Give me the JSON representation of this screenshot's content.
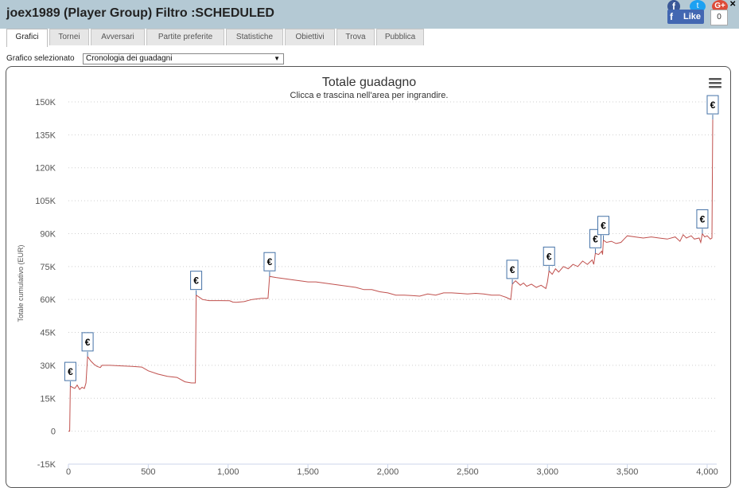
{
  "header": {
    "title": "joex1989 (Player Group) Filtro :SCHEDULED",
    "social": {
      "like_label": "Like",
      "like_count": "0",
      "facebook": "f",
      "twitter": "t",
      "gplus": "G+"
    }
  },
  "tabs": [
    {
      "label": "Grafici",
      "active": true
    },
    {
      "label": "Tornei",
      "active": false
    },
    {
      "label": "Avversari",
      "active": false
    },
    {
      "label": "Partite preferite",
      "active": false
    },
    {
      "label": "Statistiche",
      "active": false
    },
    {
      "label": "Obiettivi",
      "active": false
    },
    {
      "label": "Trova",
      "active": false
    },
    {
      "label": "Pubblica",
      "active": false
    }
  ],
  "selector": {
    "label": "Grafico selezionato",
    "value": "Cronologia dei guadagni"
  },
  "chart_data": {
    "type": "line",
    "title": "Totale guadagno",
    "subtitle": "Clicca e trascina nell'area per ingrandire.",
    "ylabel": "Totale cumulativo (EUR)",
    "xlabel": "",
    "ylim": [
      -15000,
      150000
    ],
    "xlim": [
      0,
      4060
    ],
    "grid": "horizontal-dotted",
    "y_ticks": [
      {
        "value": -15000,
        "label": "-15K"
      },
      {
        "value": 0,
        "label": "0"
      },
      {
        "value": 15000,
        "label": "15K"
      },
      {
        "value": 30000,
        "label": "30K"
      },
      {
        "value": 45000,
        "label": "45K"
      },
      {
        "value": 60000,
        "label": "60K"
      },
      {
        "value": 75000,
        "label": "75K"
      },
      {
        "value": 90000,
        "label": "90K"
      },
      {
        "value": 105000,
        "label": "105K"
      },
      {
        "value": 120000,
        "label": "120K"
      },
      {
        "value": 135000,
        "label": "135K"
      },
      {
        "value": 150000,
        "label": "150K"
      }
    ],
    "x_ticks": [
      {
        "value": 0,
        "label": "0"
      },
      {
        "value": 500,
        "label": "500"
      },
      {
        "value": 1000,
        "label": "1,000"
      },
      {
        "value": 1500,
        "label": "1,500"
      },
      {
        "value": 2000,
        "label": "2,000"
      },
      {
        "value": 2500,
        "label": "2,500"
      },
      {
        "value": 3000,
        "label": "3,000"
      },
      {
        "value": 3500,
        "label": "3,500"
      },
      {
        "value": 4000,
        "label": "4,000"
      }
    ],
    "series": [
      {
        "color": "#c0504d",
        "points": [
          [
            0,
            0
          ],
          [
            8,
            0
          ],
          [
            12,
            20500
          ],
          [
            25,
            20000
          ],
          [
            40,
            19500
          ],
          [
            55,
            21000
          ],
          [
            70,
            19000
          ],
          [
            85,
            20000
          ],
          [
            100,
            19500
          ],
          [
            110,
            22000
          ],
          [
            120,
            34000
          ],
          [
            140,
            32000
          ],
          [
            160,
            30500
          ],
          [
            180,
            29500
          ],
          [
            200,
            29000
          ],
          [
            210,
            30000
          ],
          [
            260,
            30000
          ],
          [
            320,
            29800
          ],
          [
            400,
            29500
          ],
          [
            460,
            29200
          ],
          [
            500,
            27500
          ],
          [
            560,
            26000
          ],
          [
            620,
            25000
          ],
          [
            680,
            24500
          ],
          [
            730,
            22500
          ],
          [
            770,
            22000
          ],
          [
            795,
            22000
          ],
          [
            800,
            62000
          ],
          [
            820,
            61000
          ],
          [
            840,
            60000
          ],
          [
            880,
            59500
          ],
          [
            950,
            59500
          ],
          [
            1010,
            59400
          ],
          [
            1030,
            58800
          ],
          [
            1050,
            58700
          ],
          [
            1100,
            59000
          ],
          [
            1150,
            60000
          ],
          [
            1210,
            60500
          ],
          [
            1250,
            60500
          ],
          [
            1260,
            70500
          ],
          [
            1300,
            70000
          ],
          [
            1350,
            69500
          ],
          [
            1400,
            69000
          ],
          [
            1450,
            68500
          ],
          [
            1500,
            68000
          ],
          [
            1550,
            68000
          ],
          [
            1600,
            67500
          ],
          [
            1650,
            67000
          ],
          [
            1700,
            66500
          ],
          [
            1750,
            66000
          ],
          [
            1800,
            65500
          ],
          [
            1850,
            64500
          ],
          [
            1900,
            64500
          ],
          [
            1950,
            63500
          ],
          [
            2000,
            63000
          ],
          [
            2050,
            62000
          ],
          [
            2100,
            62000
          ],
          [
            2150,
            61800
          ],
          [
            2200,
            61500
          ],
          [
            2250,
            62500
          ],
          [
            2300,
            62000
          ],
          [
            2350,
            63000
          ],
          [
            2400,
            63000
          ],
          [
            2450,
            62800
          ],
          [
            2500,
            62500
          ],
          [
            2550,
            62800
          ],
          [
            2600,
            62500
          ],
          [
            2650,
            62000
          ],
          [
            2700,
            62000
          ],
          [
            2740,
            61000
          ],
          [
            2770,
            60000
          ],
          [
            2780,
            67000
          ],
          [
            2800,
            68500
          ],
          [
            2830,
            66500
          ],
          [
            2850,
            67500
          ],
          [
            2870,
            66000
          ],
          [
            2900,
            67000
          ],
          [
            2930,
            65500
          ],
          [
            2960,
            66500
          ],
          [
            2990,
            65000
          ],
          [
            3000,
            68000
          ],
          [
            3010,
            73000
          ],
          [
            3030,
            71500
          ],
          [
            3050,
            74000
          ],
          [
            3070,
            72500
          ],
          [
            3100,
            75000
          ],
          [
            3130,
            74000
          ],
          [
            3160,
            76000
          ],
          [
            3190,
            75000
          ],
          [
            3220,
            77500
          ],
          [
            3250,
            76000
          ],
          [
            3280,
            78000
          ],
          [
            3290,
            76000
          ],
          [
            3300,
            81000
          ],
          [
            3320,
            80500
          ],
          [
            3340,
            82000
          ],
          [
            3345,
            80500
          ],
          [
            3350,
            87000
          ],
          [
            3370,
            86000
          ],
          [
            3400,
            86500
          ],
          [
            3430,
            85500
          ],
          [
            3460,
            86000
          ],
          [
            3480,
            87500
          ],
          [
            3500,
            89000
          ],
          [
            3550,
            88500
          ],
          [
            3600,
            88000
          ],
          [
            3650,
            88500
          ],
          [
            3700,
            88000
          ],
          [
            3750,
            87500
          ],
          [
            3800,
            88500
          ],
          [
            3830,
            86500
          ],
          [
            3850,
            89500
          ],
          [
            3870,
            88000
          ],
          [
            3900,
            89000
          ],
          [
            3920,
            87500
          ],
          [
            3950,
            88000
          ],
          [
            3960,
            86000
          ],
          [
            3970,
            90000
          ],
          [
            3985,
            88500
          ],
          [
            4000,
            89000
          ],
          [
            4020,
            87500
          ],
          [
            4030,
            88000
          ],
          [
            4035,
            142000
          ]
        ]
      }
    ],
    "markers": [
      {
        "x": 12,
        "y": 20500,
        "label": "€"
      },
      {
        "x": 120,
        "y": 34000,
        "label": "€"
      },
      {
        "x": 800,
        "y": 62000,
        "label": "€"
      },
      {
        "x": 1260,
        "y": 70500,
        "label": "€"
      },
      {
        "x": 2780,
        "y": 67000,
        "label": "€"
      },
      {
        "x": 3010,
        "y": 73000,
        "label": "€"
      },
      {
        "x": 3300,
        "y": 81000,
        "label": "€"
      },
      {
        "x": 3350,
        "y": 87000,
        "label": "€"
      },
      {
        "x": 3970,
        "y": 90000,
        "label": "€"
      },
      {
        "x": 4035,
        "y": 142000,
        "label": "€"
      }
    ]
  }
}
